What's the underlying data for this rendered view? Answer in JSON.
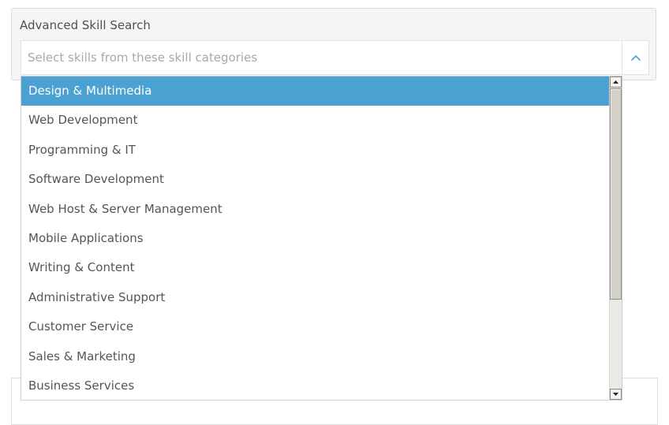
{
  "search": {
    "title": "Advanced Skill Search",
    "placeholder": "Select skills from these skill categories",
    "toggle_icon": "chevron-up-icon"
  },
  "dropdown": {
    "active_index": 0,
    "options": [
      "Design & Multimedia",
      "Web Development",
      "Programming & IT",
      "Software Development",
      "Web Host & Server Management",
      "Mobile Applications",
      "Writing & Content",
      "Administrative Support",
      "Customer Service",
      "Sales & Marketing",
      "Business Services"
    ]
  },
  "colors": {
    "active_bg": "#4ca1d3",
    "accent_chevron": "#4ca1d3"
  }
}
